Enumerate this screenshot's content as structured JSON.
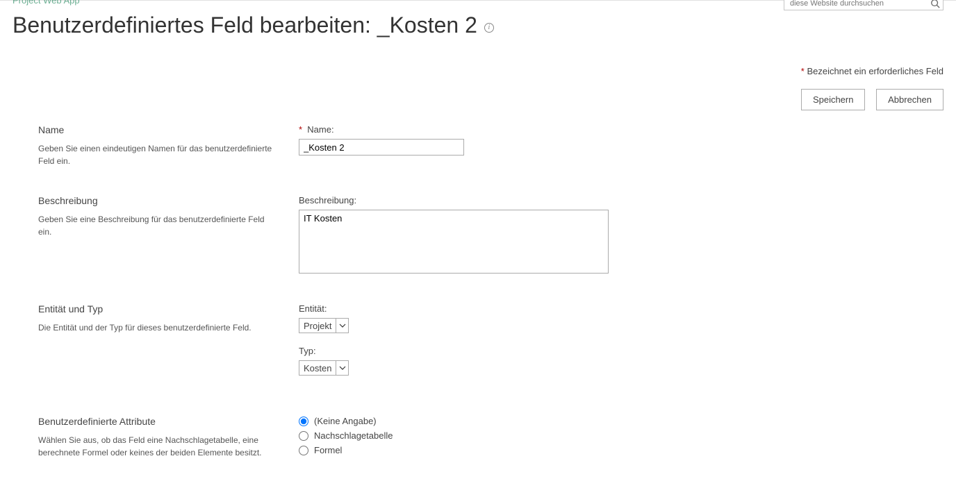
{
  "breadcrumb": "Project Web App",
  "search": {
    "placeholder": "diese Website durchsuchen"
  },
  "title": "Benutzerdefiniertes Feld bearbeiten: _Kosten 2",
  "required_note": "Bezeichnet ein erforderliches Feld",
  "buttons": {
    "save": "Speichern",
    "cancel": "Abbrechen"
  },
  "sections": {
    "name": {
      "title": "Name",
      "desc": "Geben Sie einen eindeutigen Namen für das benutzerdefinierte Feld ein.",
      "field_label": "Name:",
      "value": "_Kosten 2"
    },
    "description": {
      "title": "Beschreibung",
      "desc": "Geben Sie eine Beschreibung für das benutzerdefinierte Feld ein.",
      "field_label": "Beschreibung:",
      "value": "IT Kosten"
    },
    "entity": {
      "title": "Entität und Typ",
      "desc": "Die Entität und der Typ für dieses benutzerdefinierte Feld.",
      "entity_label": "Entität:",
      "entity_value": "Projekt",
      "type_label": "Typ:",
      "type_value": "Kosten"
    },
    "attrs": {
      "title": "Benutzerdefinierte Attribute",
      "desc": "Wählen Sie aus, ob das Feld eine Nachschlagetabelle, eine berechnete Formel oder keines der beiden Elemente besitzt.",
      "options": {
        "none": "(Keine Angabe)",
        "lookup": "Nachschlagetabelle",
        "formula": "Formel"
      },
      "selected": "none"
    }
  }
}
